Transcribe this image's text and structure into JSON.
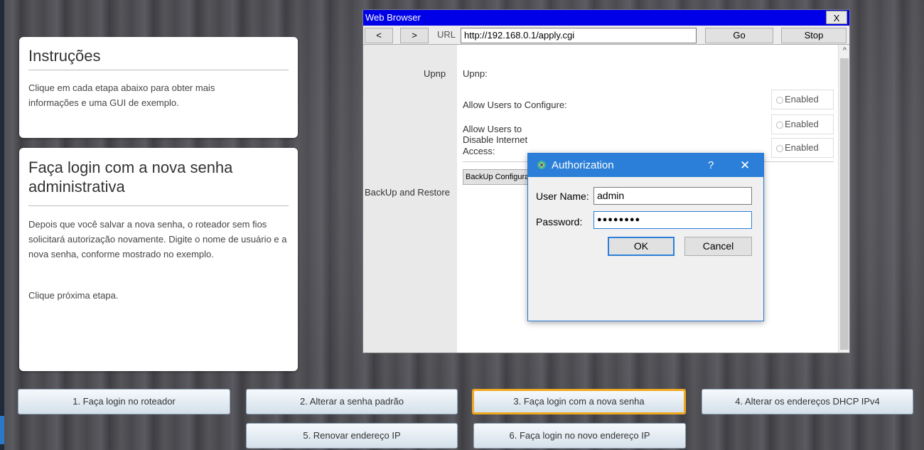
{
  "instructions": {
    "title": "Instruções",
    "text": "Clique em cada etapa abaixo para obter mais informações e uma GUI de exemplo."
  },
  "step_panel": {
    "title": "Faça login com a nova senha administrativa",
    "paragraph1": "Depois que você salvar a nova senha, o roteador sem fios solicitará autorização novamente. Digite o nome de usuário e a nova senha, conforme mostrado no exemplo.",
    "paragraph2": "Clique próxima etapa."
  },
  "browser": {
    "title": "Web Browser",
    "close_label": "X",
    "back_label": "<",
    "forward_label": ">",
    "url_label": "URL",
    "url": "http://192.168.0.1/apply.cgi",
    "go_label": "Go",
    "stop_label": "Stop",
    "scroll_up": "^",
    "page": {
      "upnp_side": "Upnp",
      "upnp_title": "Upnp:",
      "allow_configure": "Allow Users to Configure:",
      "allow_disable_line1": "Allow Users to",
      "allow_disable_line2": "Disable Internet",
      "allow_disable_line3": "Access:",
      "enabled_label": "Enabled",
      "backup_side": "BackUp and Restore",
      "backup_button": "BackUp Configura"
    }
  },
  "auth_dialog": {
    "title": "Authorization",
    "help": "?",
    "close": "✕",
    "username_label": "User Name:",
    "username_value": "admin",
    "password_label": "Password:",
    "password_value": "●●●●●●●●",
    "ok_label": "OK",
    "cancel_label": "Cancel"
  },
  "steps": [
    {
      "label": "1. Faça login no roteador"
    },
    {
      "label": "2. Alterar a senha padrão"
    },
    {
      "label": "3. Faça login com a nova senha"
    },
    {
      "label": "4. Alterar os endereços DHCP IPv4"
    },
    {
      "label": "5. Renovar endereço IP"
    },
    {
      "label": "6. Faça login no novo endereço IP"
    }
  ],
  "active_step": 3,
  "colors": {
    "browser_titlebar": "#0000e8",
    "dialog_titlebar": "#2b7fd8",
    "active_step_border": "#f0a820"
  }
}
